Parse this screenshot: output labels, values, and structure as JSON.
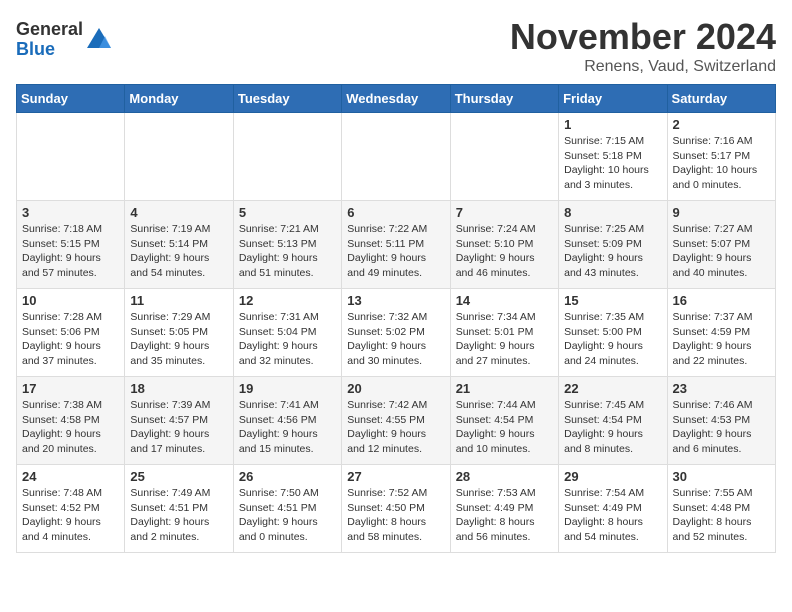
{
  "logo": {
    "general": "General",
    "blue": "Blue"
  },
  "header": {
    "month": "November 2024",
    "location": "Renens, Vaud, Switzerland"
  },
  "weekdays": [
    "Sunday",
    "Monday",
    "Tuesday",
    "Wednesday",
    "Thursday",
    "Friday",
    "Saturday"
  ],
  "weeks": [
    [
      {
        "day": "",
        "info": ""
      },
      {
        "day": "",
        "info": ""
      },
      {
        "day": "",
        "info": ""
      },
      {
        "day": "",
        "info": ""
      },
      {
        "day": "",
        "info": ""
      },
      {
        "day": "1",
        "info": "Sunrise: 7:15 AM\nSunset: 5:18 PM\nDaylight: 10 hours\nand 3 minutes."
      },
      {
        "day": "2",
        "info": "Sunrise: 7:16 AM\nSunset: 5:17 PM\nDaylight: 10 hours\nand 0 minutes."
      }
    ],
    [
      {
        "day": "3",
        "info": "Sunrise: 7:18 AM\nSunset: 5:15 PM\nDaylight: 9 hours\nand 57 minutes."
      },
      {
        "day": "4",
        "info": "Sunrise: 7:19 AM\nSunset: 5:14 PM\nDaylight: 9 hours\nand 54 minutes."
      },
      {
        "day": "5",
        "info": "Sunrise: 7:21 AM\nSunset: 5:13 PM\nDaylight: 9 hours\nand 51 minutes."
      },
      {
        "day": "6",
        "info": "Sunrise: 7:22 AM\nSunset: 5:11 PM\nDaylight: 9 hours\nand 49 minutes."
      },
      {
        "day": "7",
        "info": "Sunrise: 7:24 AM\nSunset: 5:10 PM\nDaylight: 9 hours\nand 46 minutes."
      },
      {
        "day": "8",
        "info": "Sunrise: 7:25 AM\nSunset: 5:09 PM\nDaylight: 9 hours\nand 43 minutes."
      },
      {
        "day": "9",
        "info": "Sunrise: 7:27 AM\nSunset: 5:07 PM\nDaylight: 9 hours\nand 40 minutes."
      }
    ],
    [
      {
        "day": "10",
        "info": "Sunrise: 7:28 AM\nSunset: 5:06 PM\nDaylight: 9 hours\nand 37 minutes."
      },
      {
        "day": "11",
        "info": "Sunrise: 7:29 AM\nSunset: 5:05 PM\nDaylight: 9 hours\nand 35 minutes."
      },
      {
        "day": "12",
        "info": "Sunrise: 7:31 AM\nSunset: 5:04 PM\nDaylight: 9 hours\nand 32 minutes."
      },
      {
        "day": "13",
        "info": "Sunrise: 7:32 AM\nSunset: 5:02 PM\nDaylight: 9 hours\nand 30 minutes."
      },
      {
        "day": "14",
        "info": "Sunrise: 7:34 AM\nSunset: 5:01 PM\nDaylight: 9 hours\nand 27 minutes."
      },
      {
        "day": "15",
        "info": "Sunrise: 7:35 AM\nSunset: 5:00 PM\nDaylight: 9 hours\nand 24 minutes."
      },
      {
        "day": "16",
        "info": "Sunrise: 7:37 AM\nSunset: 4:59 PM\nDaylight: 9 hours\nand 22 minutes."
      }
    ],
    [
      {
        "day": "17",
        "info": "Sunrise: 7:38 AM\nSunset: 4:58 PM\nDaylight: 9 hours\nand 20 minutes."
      },
      {
        "day": "18",
        "info": "Sunrise: 7:39 AM\nSunset: 4:57 PM\nDaylight: 9 hours\nand 17 minutes."
      },
      {
        "day": "19",
        "info": "Sunrise: 7:41 AM\nSunset: 4:56 PM\nDaylight: 9 hours\nand 15 minutes."
      },
      {
        "day": "20",
        "info": "Sunrise: 7:42 AM\nSunset: 4:55 PM\nDaylight: 9 hours\nand 12 minutes."
      },
      {
        "day": "21",
        "info": "Sunrise: 7:44 AM\nSunset: 4:54 PM\nDaylight: 9 hours\nand 10 minutes."
      },
      {
        "day": "22",
        "info": "Sunrise: 7:45 AM\nSunset: 4:54 PM\nDaylight: 9 hours\nand 8 minutes."
      },
      {
        "day": "23",
        "info": "Sunrise: 7:46 AM\nSunset: 4:53 PM\nDaylight: 9 hours\nand 6 minutes."
      }
    ],
    [
      {
        "day": "24",
        "info": "Sunrise: 7:48 AM\nSunset: 4:52 PM\nDaylight: 9 hours\nand 4 minutes."
      },
      {
        "day": "25",
        "info": "Sunrise: 7:49 AM\nSunset: 4:51 PM\nDaylight: 9 hours\nand 2 minutes."
      },
      {
        "day": "26",
        "info": "Sunrise: 7:50 AM\nSunset: 4:51 PM\nDaylight: 9 hours\nand 0 minutes."
      },
      {
        "day": "27",
        "info": "Sunrise: 7:52 AM\nSunset: 4:50 PM\nDaylight: 8 hours\nand 58 minutes."
      },
      {
        "day": "28",
        "info": "Sunrise: 7:53 AM\nSunset: 4:49 PM\nDaylight: 8 hours\nand 56 minutes."
      },
      {
        "day": "29",
        "info": "Sunrise: 7:54 AM\nSunset: 4:49 PM\nDaylight: 8 hours\nand 54 minutes."
      },
      {
        "day": "30",
        "info": "Sunrise: 7:55 AM\nSunset: 4:48 PM\nDaylight: 8 hours\nand 52 minutes."
      }
    ]
  ]
}
